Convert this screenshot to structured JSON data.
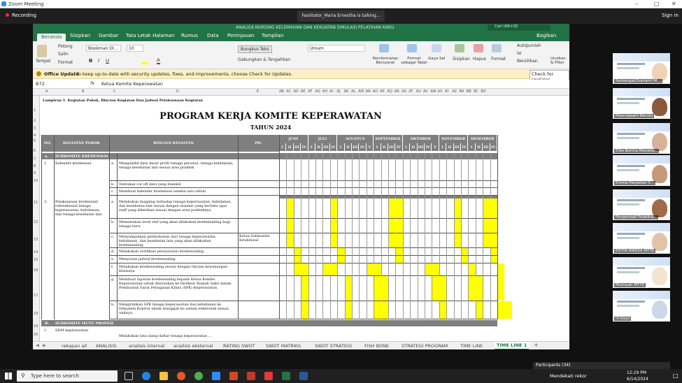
{
  "zoom": {
    "window_title": "Zoom Meeting",
    "recording_label": "Recording",
    "talking_banner": "Fasilitator_Maria Ernestha is talking...",
    "signin_label": "Sign in",
    "participants_label": "Participants (34)",
    "participants": [
      "Semangat/Sumarni M...",
      "Masnagaeni Berutu",
      "Elda Bertha Manjela...",
      "Emma Panjaitan S...",
      "Pengendali Pelatiha...",
      "ENTIN ANISSA MTTE",
      "Mutriyati MTTE",
      "m.kayu"
    ]
  },
  "excel": {
    "title": "ANALISA NURSING KELEMAHAN DAN KEKUATAN SIMULASI PELATIHAN KARU",
    "search_placeholder": "Cari (Alt+Q)",
    "share": "Bagikan",
    "tabs": [
      "Beranda",
      "Sisipkan",
      "Gambar",
      "Tata Letak Halaman",
      "Rumus",
      "Data",
      "Peninjauan",
      "Tampilan"
    ],
    "ribbon": {
      "potong": "Potong",
      "salin": "Salin",
      "format": "Format",
      "tempel": "Tempel",
      "font": "Bookman Ol...",
      "size": "10",
      "wrap": "Bungkus Teks",
      "merge": "Gabungkan & Tengahkan",
      "numfmt": "Umum",
      "cond": "Pemformatan Bersyarat",
      "fmt_table": "Format sebagai Tabel",
      "styles": "Gaya Sel",
      "insert": "Sisipkan",
      "delete": "Hapus",
      "format_cell": "Format",
      "autosum": "AutoJumlah",
      "fill": "Isi",
      "clear": "Bersihkan",
      "sort": "Urutkan & Filter"
    },
    "msg_title": "Office Update",
    "msg_text": "To keep up-to-date with security updates, fixes, and improvements, choose Check for Updates.",
    "msg_button": "Check for Updates",
    "name_box": "B72",
    "formula": "Ketua Komite Keperawatan",
    "sheet": {
      "lampiran": "Lampiran 1. Kegiatan Pokok, Rincian Kegiatan Dan Jadwal Pelaksanaan Kegiatan",
      "title": "PROGRAM KERJA KOMITE KEPERAWATAN",
      "subtitle": "TAHUN 2024",
      "h_no": "NO.",
      "h_kegiatan": "KEGIATAN POKOK",
      "h_rincian": "RINCIAN KEGIATAN",
      "h_pic": "PIC",
      "months": [
        "JUNI",
        "JULI",
        "AGUSTUS",
        "SEPTEMBER",
        "OKTOBER",
        "NOVEMBER",
        "DESEMBER"
      ],
      "weeks": [
        [
          "I",
          "II",
          "III",
          "IV"
        ],
        [
          "I",
          "II",
          "III",
          "IV"
        ],
        [
          "I",
          "II",
          "III",
          "IV",
          "V"
        ],
        [
          "I",
          "II",
          "III",
          "IV"
        ],
        [
          "I",
          "II",
          "III",
          "IV",
          "V"
        ],
        [
          "I",
          "II",
          "III",
          "IV"
        ],
        [
          "I",
          "II",
          "III",
          "IV"
        ]
      ],
      "section_a": "a.",
      "section_a_label": "SUBKOMITE KREDENSIAL",
      "section_b": "B.",
      "section_b_label": "SUBKOMITE MUTU PROFESI",
      "pic_text": "Ketua Subkomite Kredensial",
      "rows": [
        {
          "no": "1.",
          "pokok": "Kalender kredensial",
          "letter": "a.",
          "rincian": "Mengambil data dasar profil tenaga perawat, tenaga kebidanan, tenaga kesehatan lain sesuai area praktek"
        },
        {
          "no": "",
          "pokok": "",
          "letter": "b.",
          "rincian": "Tentukan cut off data yang diambil"
        },
        {
          "no": "",
          "pokok": "",
          "letter": "c.",
          "rincian": "Membuat kalender kredensial selama satu tahun"
        },
        {
          "no": "2.",
          "pokok": "Pelaksanaan kredensial/ rekredensial tenaga keperawatan, kebidanan, dan tenaga kesehatan lain",
          "letter": "a.",
          "rincian": "Melakukan mapping terhadap tenaga keperawatan, kebidanan, dan kesehatan lain sesuai dengan standar yang berlaku agar staff yang diberikan sesuai dengan area prakteknya"
        },
        {
          "no": "",
          "pokok": "",
          "letter": "b.",
          "rincian": "Menentukan level staf yang akan dilakukan kredensialing bagi tenaga baru"
        },
        {
          "no": "",
          "pokok": "",
          "letter": "c.",
          "rincian": "Menyampaikan permohonan dari tenaga keperawatan, kebidanan, dan kesehatan lain yang akan dilakukan kredensialing"
        },
        {
          "no": "",
          "pokok": "",
          "letter": "d.",
          "rincian": "Melakukan verifikasi persyaratan kredensialing"
        },
        {
          "no": "",
          "pokok": "",
          "letter": "e.",
          "rincian": "Menyusun jadwal kredensialing"
        },
        {
          "no": "",
          "pokok": "",
          "letter": "f.",
          "rincian": "Melakukan kredensialing sesuai dengan rincian kewenangan klinisnya"
        },
        {
          "no": "",
          "pokok": "",
          "letter": "g.",
          "rincian": "Membuat laporan kredensialing kepada Ketua Komite Keperawatan untuk diteruskan ke Direktur Rumah Sakit dalam Pembuatan Surat Penugasan Klinis (SPK) Keperawatan."
        },
        {
          "no": "",
          "pokok": "",
          "letter": "h.",
          "rincian": "Mengirimkan SPK tenaga keperawatan dan kebidanan ke Dokumen Kontrol untuk diunggah ke sistem elektronik sesuai unitnya"
        }
      ],
      "row_b1_no": "1.",
      "row_b1": "SDM keperawatan",
      "row_b1_next": "Melakukan tata ulang daftar tenaga keperawatan ..."
    },
    "sheet_tabs": [
      "rekapan all",
      "ANALISIS",
      "analisis internal",
      "analisis eksternal",
      "RATING SWOT",
      "SWOT MATRIKS",
      "SWOT STRATEGI",
      "FISH BONE",
      "STRATEGI PROGRAM",
      "TIME LINE",
      "TIME LINE 1"
    ],
    "active_tab": "TIME LINE 1"
  },
  "taskbar": {
    "search_placeholder": "Type here to search",
    "weather": "Mendekati rekor",
    "time": "12:29 PM",
    "date": "6/14/2024"
  },
  "colors": {
    "excel_green": "#217346",
    "highlight": "#ffff00",
    "header_gray": "#7f7f7f"
  }
}
